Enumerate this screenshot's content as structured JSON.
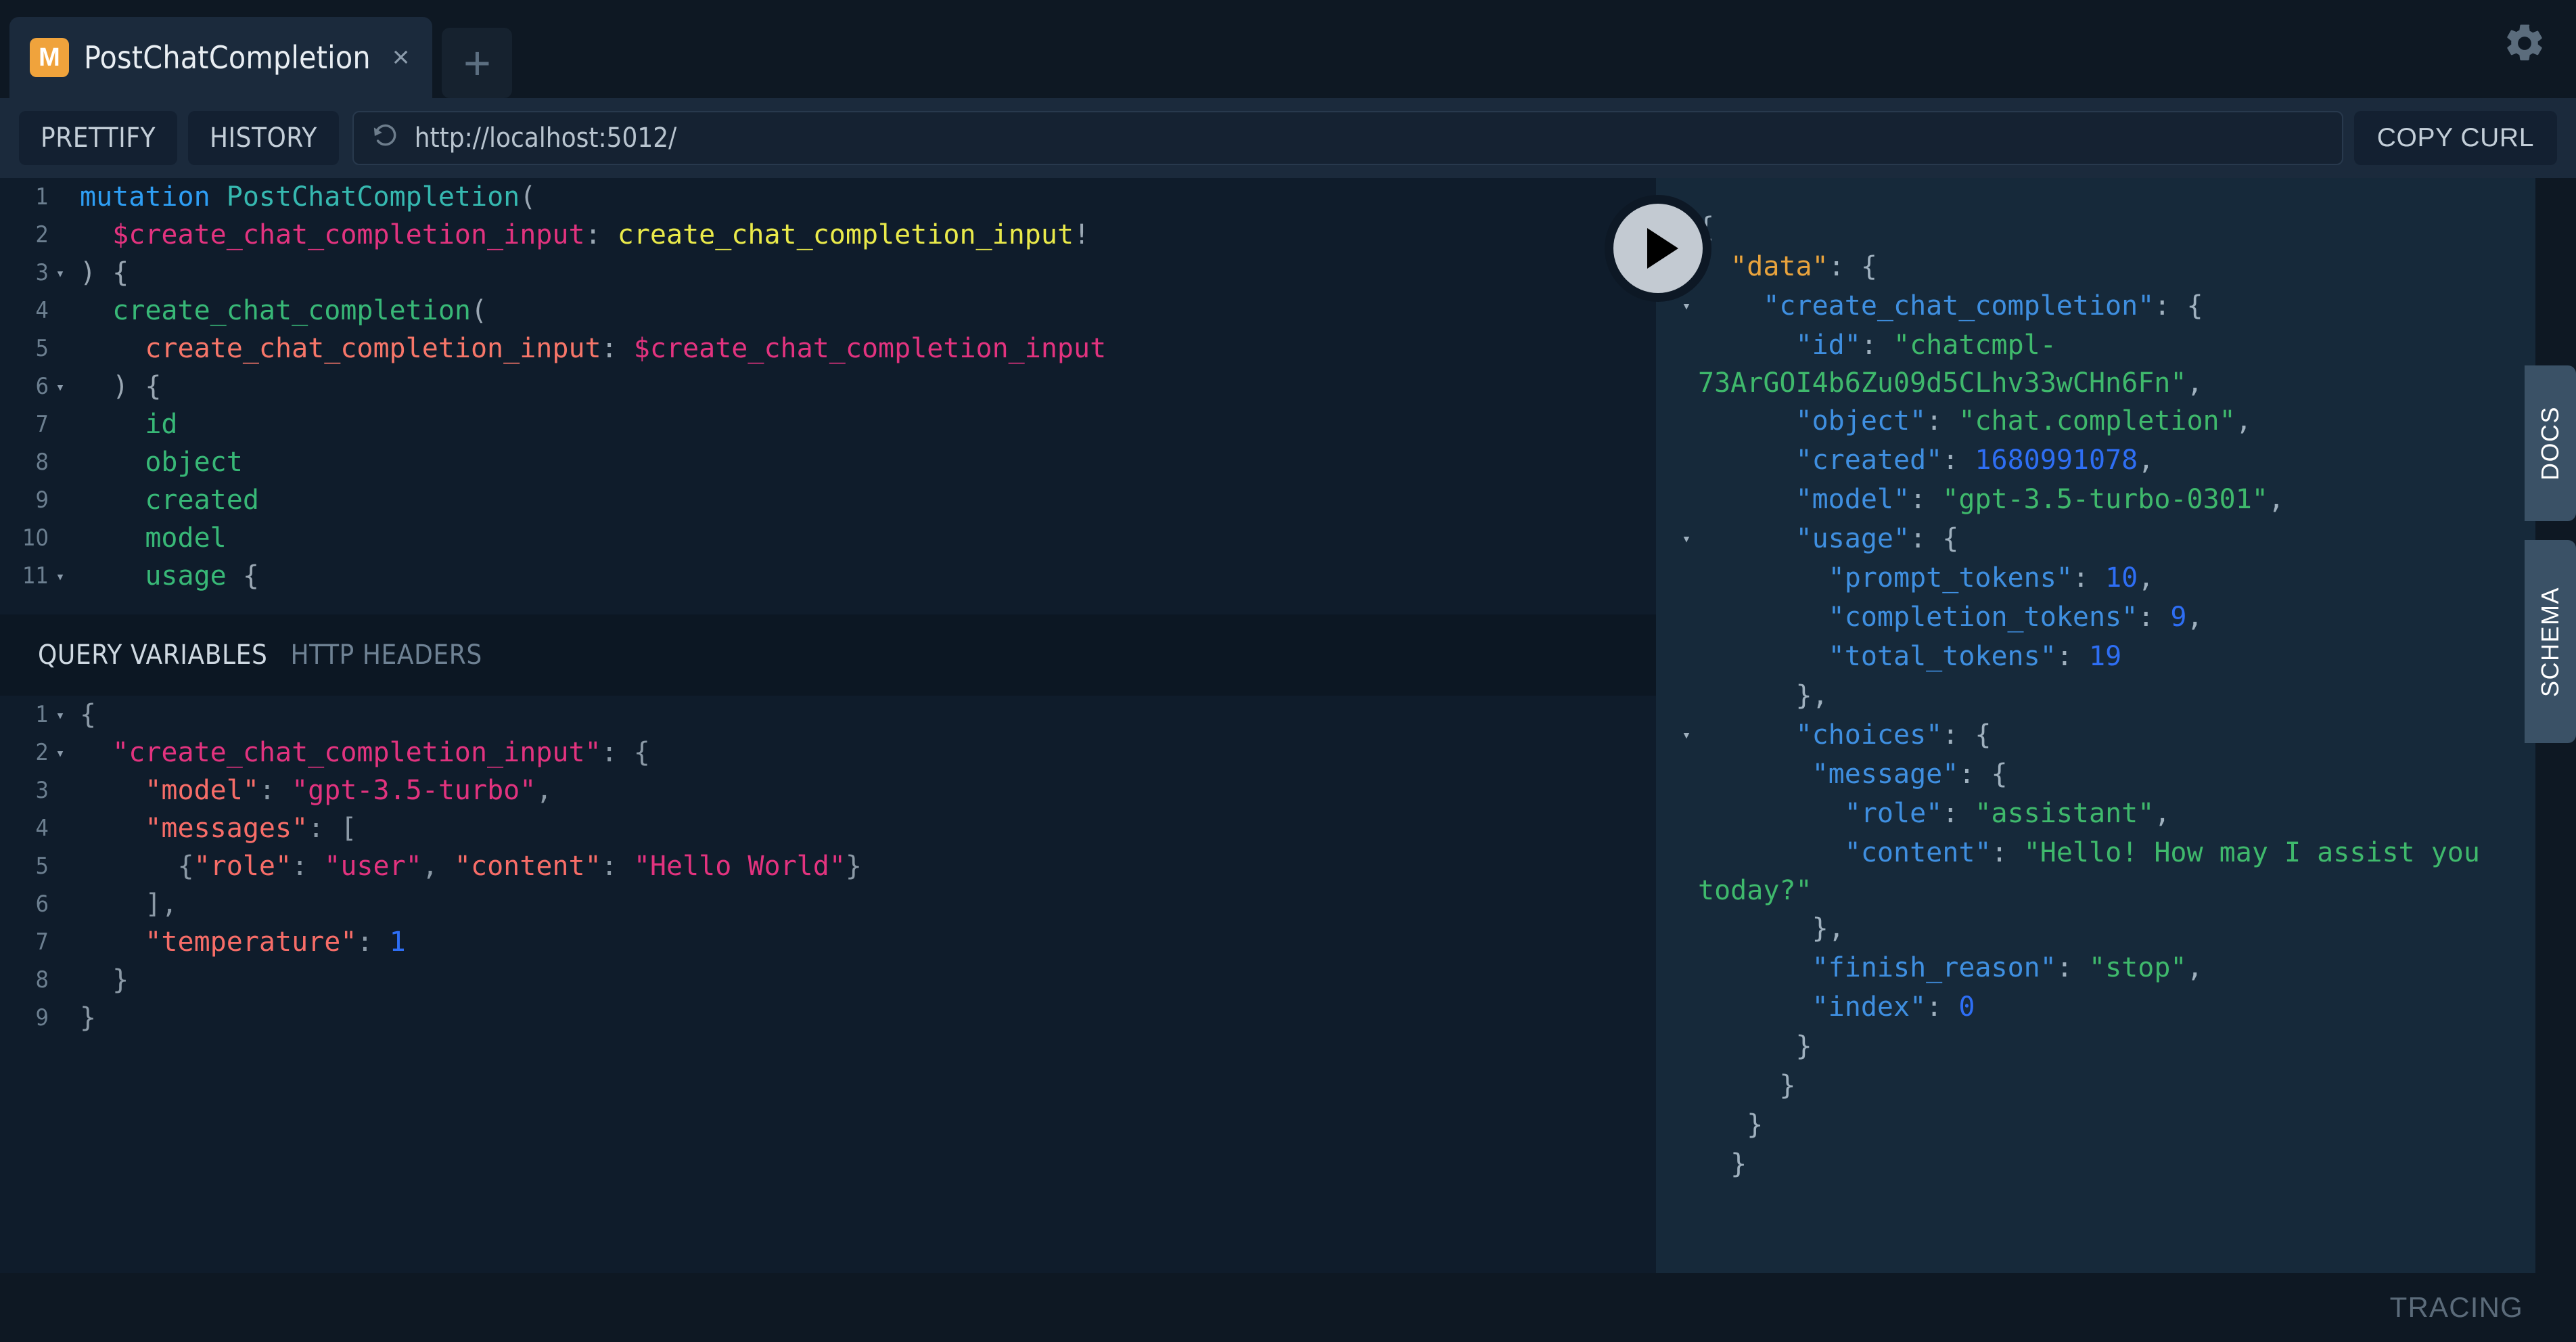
{
  "window": {
    "tab": {
      "badge": "M",
      "title": "PostChatCompletion",
      "close_label": "×",
      "add_label": "+"
    },
    "settings_icon": "gear-icon"
  },
  "toolbar": {
    "prettify_label": "PRETTIFY",
    "history_label": "HISTORY",
    "url_value": "http://localhost:5012/",
    "url_icon": "history-revert-icon",
    "copy_curl_label": "COPY CURL"
  },
  "execute_button": {
    "icon": "play-icon",
    "label": "Execute Query"
  },
  "query_editor": {
    "lines": [
      {
        "n": "1",
        "fold": "",
        "tokens": [
          {
            "t": "kw",
            "s": "mutation"
          },
          {
            "t": "punc",
            "s": " "
          },
          {
            "t": "name",
            "s": "PostChatCompletion"
          },
          {
            "t": "punc",
            "s": "("
          }
        ]
      },
      {
        "n": "2",
        "fold": "",
        "tokens": [
          {
            "t": "punc",
            "s": "  "
          },
          {
            "t": "var",
            "s": "$create_chat_completion_input"
          },
          {
            "t": "punc",
            "s": ": "
          },
          {
            "t": "type",
            "s": "create_chat_completion_input"
          },
          {
            "t": "punc",
            "s": "!"
          }
        ]
      },
      {
        "n": "3",
        "fold": "▾",
        "tokens": [
          {
            "t": "punc",
            "s": ") {"
          }
        ]
      },
      {
        "n": "4",
        "fold": "",
        "tokens": [
          {
            "t": "punc",
            "s": "  "
          },
          {
            "t": "field",
            "s": "create_chat_completion"
          },
          {
            "t": "punc",
            "s": "("
          }
        ]
      },
      {
        "n": "5",
        "fold": "",
        "tokens": [
          {
            "t": "punc",
            "s": "    "
          },
          {
            "t": "arg",
            "s": "create_chat_completion_input"
          },
          {
            "t": "punc",
            "s": ": "
          },
          {
            "t": "var",
            "s": "$create_chat_completion_input"
          }
        ]
      },
      {
        "n": "6",
        "fold": "▾",
        "tokens": [
          {
            "t": "punc",
            "s": "  ) {"
          }
        ]
      },
      {
        "n": "7",
        "fold": "",
        "tokens": [
          {
            "t": "punc",
            "s": "    "
          },
          {
            "t": "field",
            "s": "id"
          }
        ]
      },
      {
        "n": "8",
        "fold": "",
        "tokens": [
          {
            "t": "punc",
            "s": "    "
          },
          {
            "t": "field",
            "s": "object"
          }
        ]
      },
      {
        "n": "9",
        "fold": "",
        "tokens": [
          {
            "t": "punc",
            "s": "    "
          },
          {
            "t": "field",
            "s": "created"
          }
        ]
      },
      {
        "n": "10",
        "fold": "",
        "tokens": [
          {
            "t": "punc",
            "s": "    "
          },
          {
            "t": "field",
            "s": "model"
          }
        ]
      },
      {
        "n": "11",
        "fold": "▾",
        "tokens": [
          {
            "t": "punc",
            "s": "    "
          },
          {
            "t": "field",
            "s": "usage"
          },
          {
            "t": "punc",
            "s": " {"
          }
        ]
      }
    ]
  },
  "variables_panel": {
    "tabs": [
      {
        "label": "QUERY VARIABLES",
        "active": true
      },
      {
        "label": "HTTP HEADERS",
        "active": false
      }
    ],
    "lines": [
      {
        "n": "1",
        "fold": "▾",
        "tokens": [
          {
            "t": "punc",
            "s": "{"
          }
        ]
      },
      {
        "n": "2",
        "fold": "▾",
        "tokens": [
          {
            "t": "punc",
            "s": "  "
          },
          {
            "t": "str",
            "s": "\"create_chat_completion_input\""
          },
          {
            "t": "punc",
            "s": ": {"
          }
        ]
      },
      {
        "n": "3",
        "fold": "",
        "tokens": [
          {
            "t": "punc",
            "s": "    "
          },
          {
            "t": "key",
            "s": "\"model\""
          },
          {
            "t": "punc",
            "s": ": "
          },
          {
            "t": "str",
            "s": "\"gpt-3.5-turbo\""
          },
          {
            "t": "punc",
            "s": ","
          }
        ]
      },
      {
        "n": "4",
        "fold": "",
        "tokens": [
          {
            "t": "punc",
            "s": "    "
          },
          {
            "t": "key",
            "s": "\"messages\""
          },
          {
            "t": "punc",
            "s": ": ["
          }
        ]
      },
      {
        "n": "5",
        "fold": "",
        "tokens": [
          {
            "t": "punc",
            "s": "      {"
          },
          {
            "t": "key",
            "s": "\"role\""
          },
          {
            "t": "punc",
            "s": ": "
          },
          {
            "t": "str",
            "s": "\"user\""
          },
          {
            "t": "punc",
            "s": ", "
          },
          {
            "t": "key",
            "s": "\"content\""
          },
          {
            "t": "punc",
            "s": ": "
          },
          {
            "t": "str",
            "s": "\"Hello World\""
          },
          {
            "t": "punc",
            "s": "}"
          }
        ]
      },
      {
        "n": "6",
        "fold": "",
        "tokens": [
          {
            "t": "punc",
            "s": "    ],"
          }
        ]
      },
      {
        "n": "7",
        "fold": "",
        "tokens": [
          {
            "t": "punc",
            "s": "    "
          },
          {
            "t": "key",
            "s": "\"temperature\""
          },
          {
            "t": "punc",
            "s": ": "
          },
          {
            "t": "num",
            "s": "1"
          }
        ]
      },
      {
        "n": "8",
        "fold": "",
        "tokens": [
          {
            "t": "punc",
            "s": "  }"
          }
        ]
      },
      {
        "n": "9",
        "fold": "",
        "tokens": [
          {
            "t": "punc",
            "s": "}"
          }
        ]
      }
    ]
  },
  "response_panel": {
    "lines": [
      {
        "fold": "▾",
        "tokens": [
          {
            "t": "punc",
            "s": "{"
          }
        ]
      },
      {
        "fold": "▾",
        "tokens": [
          {
            "t": "punc",
            "s": "  "
          },
          {
            "t": "key-root",
            "s": "\"data\""
          },
          {
            "t": "punc",
            "s": ": {"
          }
        ]
      },
      {
        "fold": "▾",
        "tokens": [
          {
            "t": "punc",
            "s": "    "
          },
          {
            "t": "key",
            "s": "\"create_chat_completion\""
          },
          {
            "t": "punc",
            "s": ": {"
          }
        ]
      },
      {
        "fold": "",
        "tokens": [
          {
            "t": "punc",
            "s": "      "
          },
          {
            "t": "key",
            "s": "\"id\""
          },
          {
            "t": "punc",
            "s": ": "
          },
          {
            "t": "str",
            "s": "\"chatcmpl-73ArGOI4b6Zu09d5CLhv33wCHn6Fn\""
          },
          {
            "t": "punc",
            "s": ","
          }
        ]
      },
      {
        "fold": "",
        "tokens": [
          {
            "t": "punc",
            "s": "      "
          },
          {
            "t": "key",
            "s": "\"object\""
          },
          {
            "t": "punc",
            "s": ": "
          },
          {
            "t": "str",
            "s": "\"chat.completion\""
          },
          {
            "t": "punc",
            "s": ","
          }
        ]
      },
      {
        "fold": "",
        "tokens": [
          {
            "t": "punc",
            "s": "      "
          },
          {
            "t": "key",
            "s": "\"created\""
          },
          {
            "t": "punc",
            "s": ": "
          },
          {
            "t": "num",
            "s": "1680991078"
          },
          {
            "t": "punc",
            "s": ","
          }
        ]
      },
      {
        "fold": "",
        "tokens": [
          {
            "t": "punc",
            "s": "      "
          },
          {
            "t": "key",
            "s": "\"model\""
          },
          {
            "t": "punc",
            "s": ": "
          },
          {
            "t": "str",
            "s": "\"gpt-3.5-turbo-0301\""
          },
          {
            "t": "punc",
            "s": ","
          }
        ]
      },
      {
        "fold": "▾",
        "tokens": [
          {
            "t": "punc",
            "s": "      "
          },
          {
            "t": "key",
            "s": "\"usage\""
          },
          {
            "t": "punc",
            "s": ": {"
          }
        ]
      },
      {
        "fold": "",
        "tokens": [
          {
            "t": "punc",
            "s": "        "
          },
          {
            "t": "key",
            "s": "\"prompt_tokens\""
          },
          {
            "t": "punc",
            "s": ": "
          },
          {
            "t": "num",
            "s": "10"
          },
          {
            "t": "punc",
            "s": ","
          }
        ]
      },
      {
        "fold": "",
        "tokens": [
          {
            "t": "punc",
            "s": "        "
          },
          {
            "t": "key",
            "s": "\"completion_tokens\""
          },
          {
            "t": "punc",
            "s": ": "
          },
          {
            "t": "num",
            "s": "9"
          },
          {
            "t": "punc",
            "s": ","
          }
        ]
      },
      {
        "fold": "",
        "tokens": [
          {
            "t": "punc",
            "s": "        "
          },
          {
            "t": "key",
            "s": "\"total_tokens\""
          },
          {
            "t": "punc",
            "s": ": "
          },
          {
            "t": "num",
            "s": "19"
          }
        ]
      },
      {
        "fold": "",
        "tokens": [
          {
            "t": "punc",
            "s": "      },"
          }
        ]
      },
      {
        "fold": "▾",
        "tokens": [
          {
            "t": "punc",
            "s": "      "
          },
          {
            "t": "key",
            "s": "\"choices\""
          },
          {
            "t": "punc",
            "s": ": {"
          }
        ]
      },
      {
        "fold": "",
        "tokens": [
          {
            "t": "punc",
            "s": "       "
          },
          {
            "t": "key",
            "s": "\"message\""
          },
          {
            "t": "punc",
            "s": ": {"
          }
        ]
      },
      {
        "fold": "",
        "tokens": [
          {
            "t": "punc",
            "s": "         "
          },
          {
            "t": "key",
            "s": "\"role\""
          },
          {
            "t": "punc",
            "s": ": "
          },
          {
            "t": "str",
            "s": "\"assistant\""
          },
          {
            "t": "punc",
            "s": ","
          }
        ]
      },
      {
        "fold": "",
        "tokens": [
          {
            "t": "punc",
            "s": "         "
          },
          {
            "t": "key",
            "s": "\"content\""
          },
          {
            "t": "punc",
            "s": ": "
          },
          {
            "t": "str",
            "s": "\"Hello! How may I assist you today?\""
          }
        ]
      },
      {
        "fold": "",
        "tokens": [
          {
            "t": "punc",
            "s": "       },"
          }
        ]
      },
      {
        "fold": "",
        "tokens": [
          {
            "t": "punc",
            "s": "       "
          },
          {
            "t": "key",
            "s": "\"finish_reason\""
          },
          {
            "t": "punc",
            "s": ": "
          },
          {
            "t": "str",
            "s": "\"stop\""
          },
          {
            "t": "punc",
            "s": ","
          }
        ]
      },
      {
        "fold": "",
        "tokens": [
          {
            "t": "punc",
            "s": "       "
          },
          {
            "t": "key",
            "s": "\"index\""
          },
          {
            "t": "punc",
            "s": ": "
          },
          {
            "t": "num",
            "s": "0"
          }
        ]
      },
      {
        "fold": "",
        "tokens": [
          {
            "t": "punc",
            "s": "      }"
          }
        ]
      },
      {
        "fold": "",
        "tokens": [
          {
            "t": "punc",
            "s": "     }"
          }
        ]
      },
      {
        "fold": "",
        "tokens": [
          {
            "t": "punc",
            "s": "   }"
          }
        ]
      },
      {
        "fold": "",
        "tokens": [
          {
            "t": "punc",
            "s": "  }"
          }
        ]
      }
    ]
  },
  "side_tabs": [
    {
      "label": "DOCS"
    },
    {
      "label": "SCHEMA"
    }
  ],
  "footer": {
    "tracing_label": "TRACING"
  },
  "colors": {
    "accent_badge": "#f0a33c",
    "panel_bg": "#0f1c2b",
    "response_bg": "#16293a",
    "chrome_bg": "#0e1823",
    "toolbar_bg": "#1b2a3c",
    "side_tab": "#3a5166"
  }
}
